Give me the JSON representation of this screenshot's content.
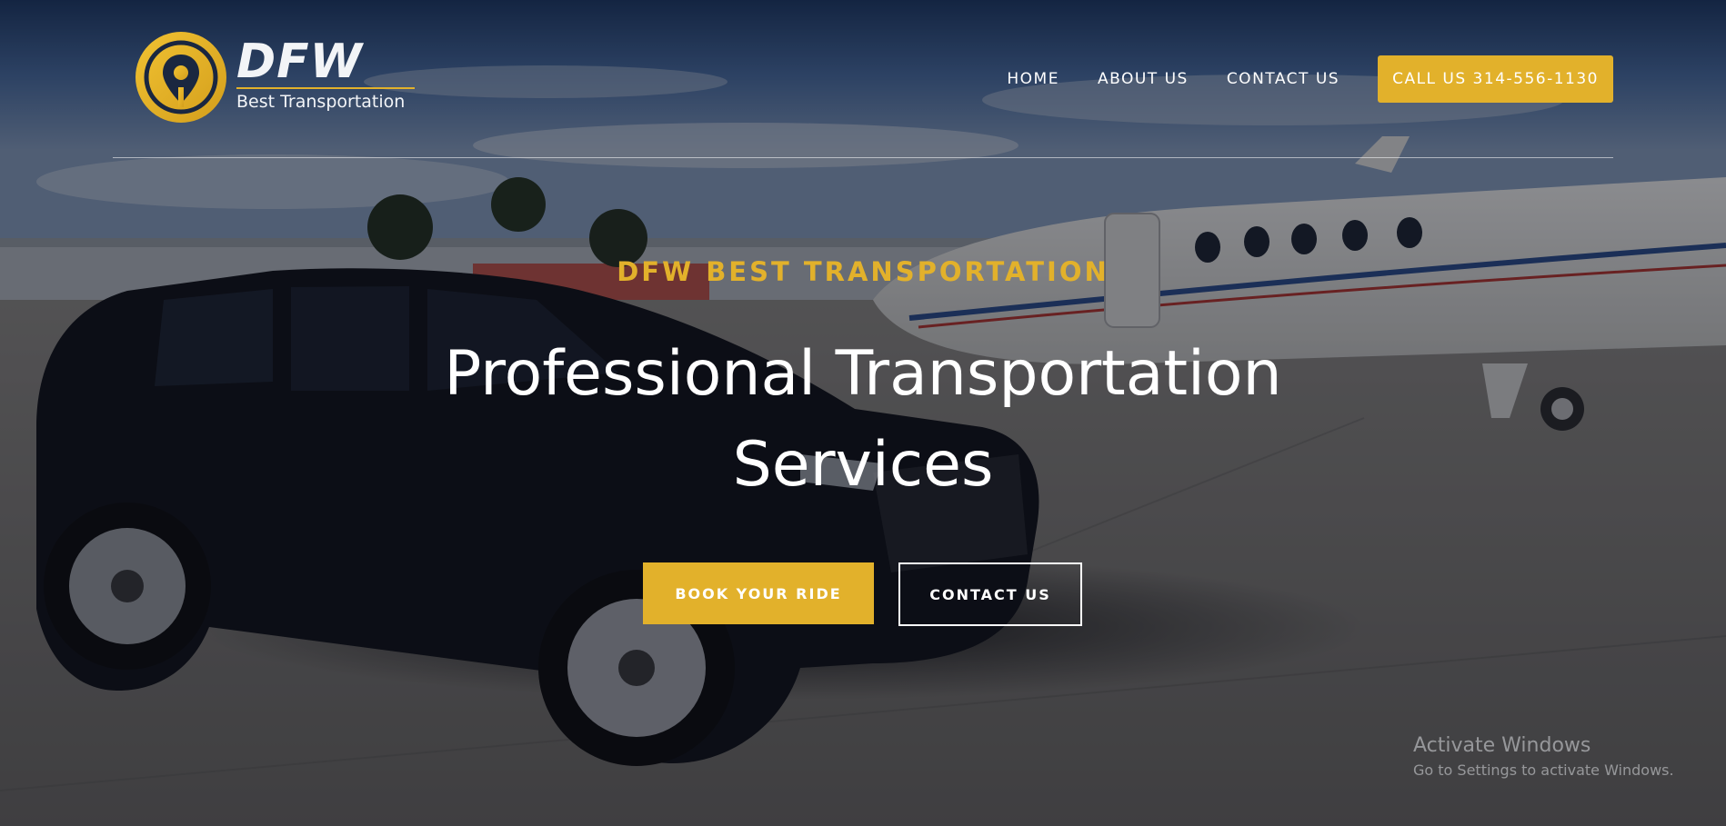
{
  "brand": {
    "name": "DFW",
    "tagline": "Best Transportation",
    "accent_color": "#e2b12b"
  },
  "nav": {
    "items": [
      {
        "label": "HOME"
      },
      {
        "label": "ABOUT US"
      },
      {
        "label": "CONTACT US"
      }
    ],
    "cta_label": "CALL US 314-556-1130"
  },
  "hero": {
    "eyebrow": "DFW BEST TRANSPORTATION",
    "headline": "Professional Transportation Services",
    "primary_button": "BOOK YOUR RIDE",
    "secondary_button": "CONTACT US",
    "background": "black SUV parked on airport tarmac next to private jet"
  },
  "os_watermark": {
    "title": "Activate Windows",
    "subtitle": "Go to Settings to activate Windows."
  }
}
